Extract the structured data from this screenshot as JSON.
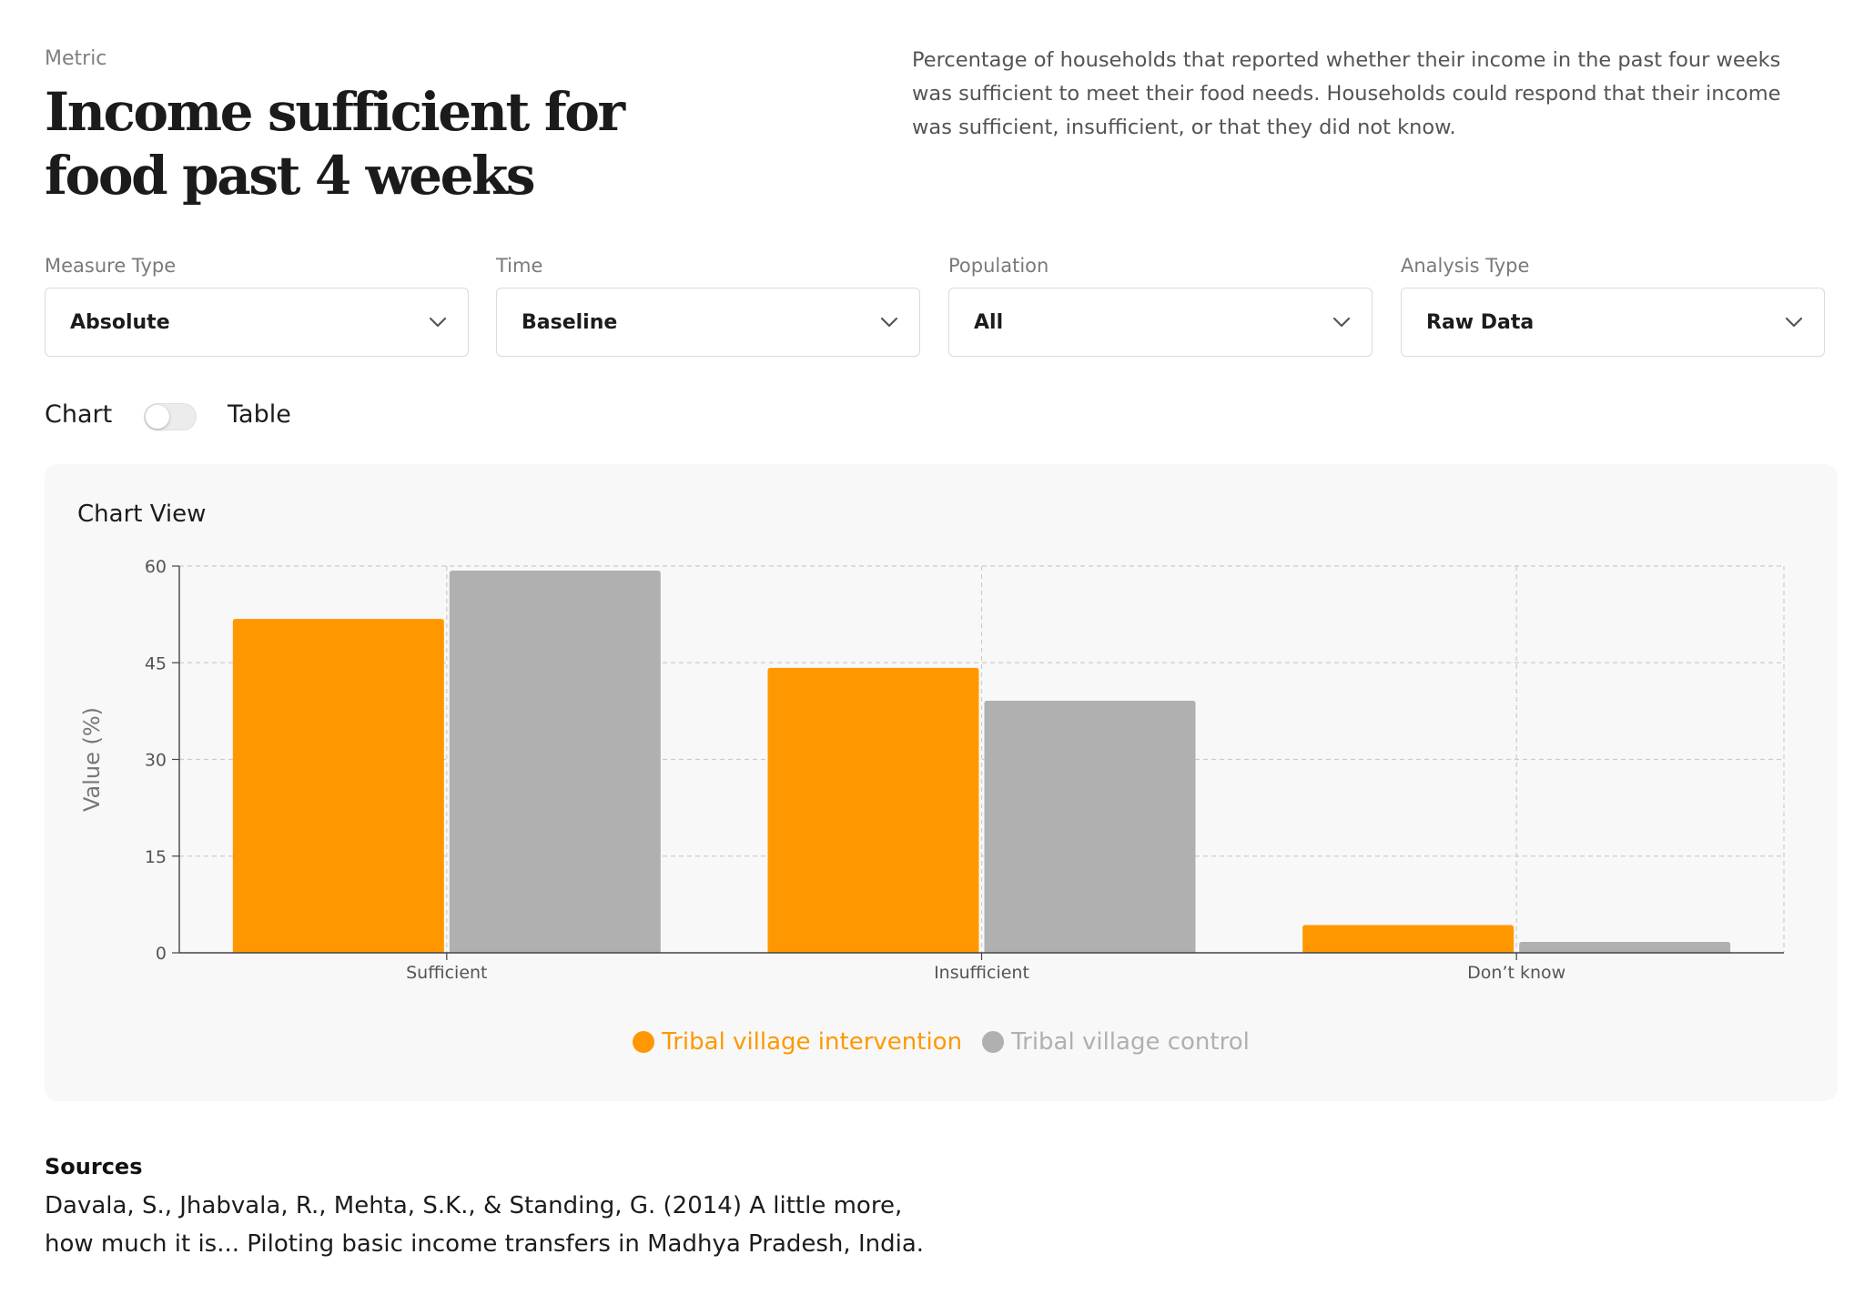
{
  "header": {
    "eyebrow": "Metric",
    "title": "Income sufficient for food past 4 weeks",
    "description": "Percentage of households that reported whether their income in the past four weeks was sufficient to meet their food needs. Households could respond that their income was sufficient, insufficient, or that they did not know."
  },
  "filters": [
    {
      "label": "Measure Type",
      "value": "Absolute"
    },
    {
      "label": "Time",
      "value": "Baseline"
    },
    {
      "label": "Population",
      "value": "All"
    },
    {
      "label": "Analysis Type",
      "value": "Raw Data"
    }
  ],
  "view_toggle": {
    "left_label": "Chart",
    "right_label": "Table",
    "state": "Chart"
  },
  "card": {
    "title": "Chart View"
  },
  "chart_data": {
    "type": "bar",
    "categories": [
      "Sufficient",
      "Insufficient",
      "Don’t know"
    ],
    "series": [
      {
        "name": "Tribal village intervention",
        "color": "#ff9800",
        "values": [
          51.8,
          44.2,
          4.3
        ]
      },
      {
        "name": "Tribal village control",
        "color": "#b0b0b0",
        "values": [
          59.3,
          39.1,
          1.7
        ]
      }
    ],
    "ylabel": "Value (%)",
    "xlabel": "",
    "ylim": [
      0,
      60
    ],
    "yticks": [
      "0",
      "15",
      "30",
      "45",
      "60"
    ],
    "grid": true,
    "legend_position": "bottom-center"
  },
  "sources": {
    "heading": "Sources",
    "text": "Davala, S., Jhabvala, R., Mehta, S.K., & Standing, G. (2014) A little more, how much it is... Piloting basic income transfers in Madhya Pradesh, India."
  }
}
